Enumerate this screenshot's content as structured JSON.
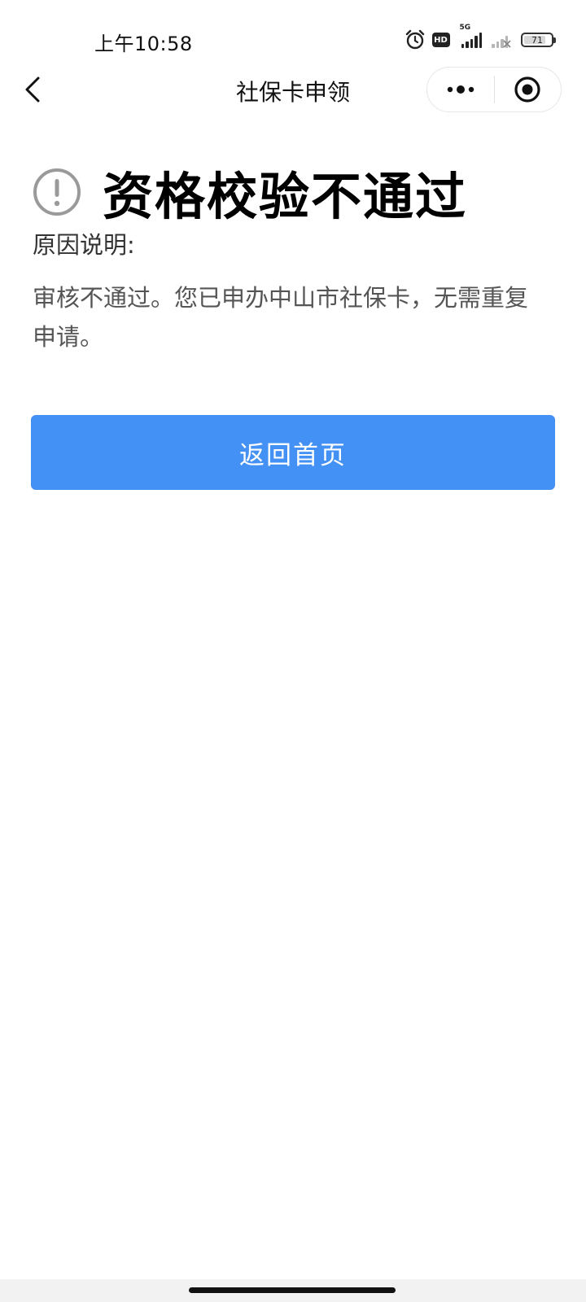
{
  "status_bar": {
    "time": "上午10:58",
    "hd_label": "HD",
    "network_label": "5G",
    "battery_level": "71"
  },
  "nav": {
    "title": "社保卡申领"
  },
  "result": {
    "title": "资格校验不通过",
    "reason_label": "原因说明:",
    "reason_text": "审核不通过。您已申办中山市社保卡，无需重复申请。"
  },
  "actions": {
    "home_button_label": "返回首页"
  },
  "colors": {
    "primary_button": "#4391f4",
    "warning_icon": "#9a9a9a"
  }
}
